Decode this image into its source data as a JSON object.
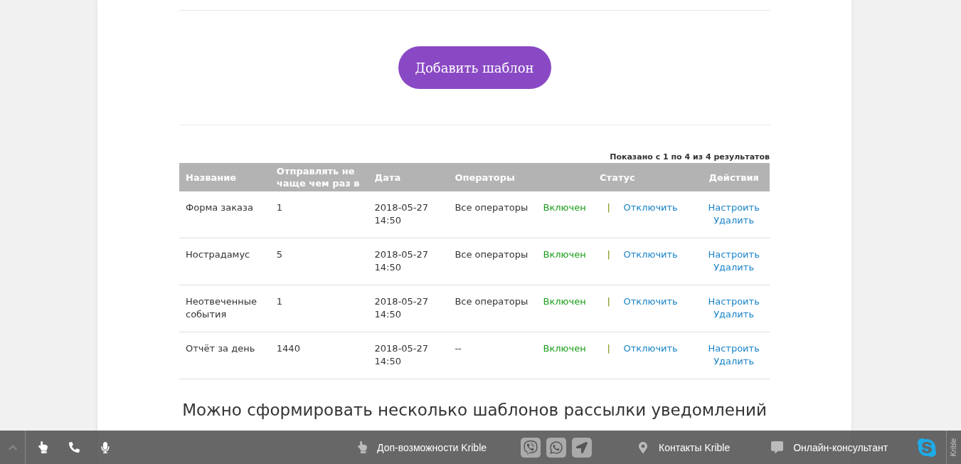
{
  "add_button": {
    "label": "Добавить шаблон"
  },
  "results_info": "Показано с 1 по 4 из 4 результатов",
  "table": {
    "columns": [
      "Название",
      "Отправлять не чаще чем раз в",
      "Дата",
      "Операторы",
      "Статус",
      "Действия"
    ],
    "rows": [
      {
        "name": "Форма заказа",
        "interval": "1",
        "date": "2018-05-27 14:50",
        "operators": "Все операторы",
        "status": "Включен",
        "enabled": true,
        "separator": "|",
        "toggle": "Отключить",
        "actions": [
          "Настроить",
          "Удалить"
        ]
      },
      {
        "name": "Нострадамус",
        "interval": "5",
        "date": "2018-05-27 14:50",
        "operators": "Все операторы",
        "status": "Включен",
        "enabled": true,
        "separator": "|",
        "toggle": "Отключить",
        "actions": [
          "Настроить",
          "Удалить"
        ]
      },
      {
        "name": "Неотвеченные события",
        "interval": "1",
        "date": "2018-05-27 14:50",
        "operators": "Все операторы",
        "status": "Включен",
        "enabled": true,
        "separator": "|",
        "toggle": "Отключить",
        "actions": [
          "Настроить",
          "Удалить"
        ]
      },
      {
        "name": "Отчёт за день",
        "interval": "1440",
        "date": "2018-05-27 14:50",
        "operators": "--",
        "status": "Включен",
        "enabled": true,
        "separator": "|",
        "toggle": "Отключить",
        "actions": [
          "Настроить",
          "Удалить"
        ]
      }
    ]
  },
  "heading": "Можно сформировать несколько шаблонов рассылки уведомлений",
  "bottom_bar": {
    "features": "Доп-возможности Krible",
    "contacts": "Контакты Krible",
    "consultant": "Онлайн-консультант",
    "vertical_label": "Krible"
  }
}
